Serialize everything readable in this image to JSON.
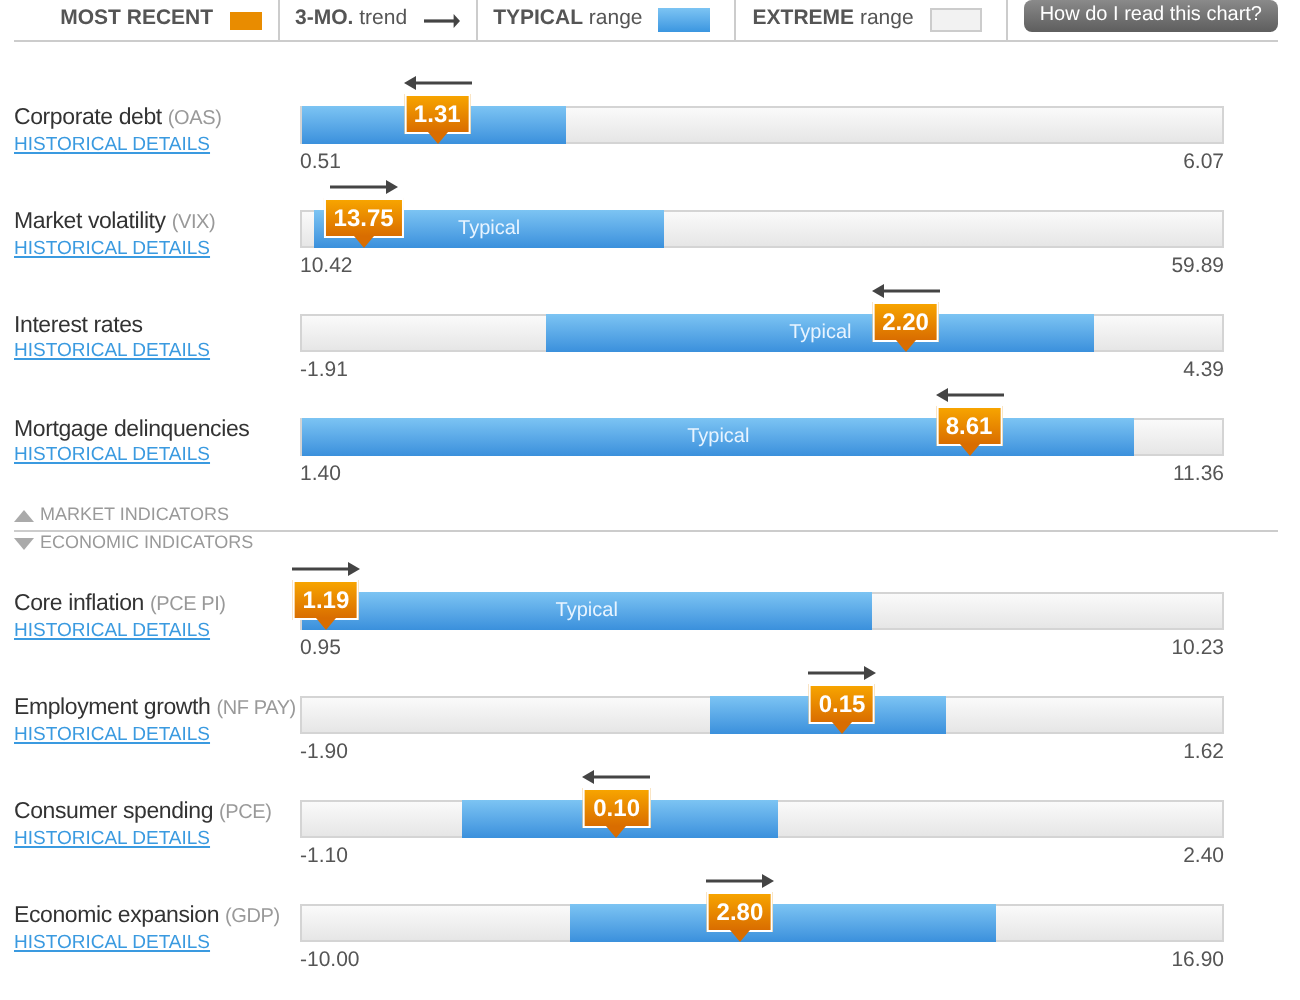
{
  "legend": {
    "most_recent": "MOST RECENT",
    "trend_bold": "3-MO.",
    "trend_rest": "trend",
    "typical_bold": "TYPICAL",
    "typical_rest": "range",
    "extreme_bold": "EXTREME",
    "extreme_rest": "range",
    "help_button": "How do I read this chart?"
  },
  "groups": [
    {
      "rows": [
        {
          "name": "Corporate debt",
          "code": "(OAS)",
          "link": "HISTORICAL DETAILS",
          "min": "0.51",
          "max": "6.07",
          "typical": {
            "level": 0.286
          },
          "marker": {
            "level": 0.147,
            "value": "1.31"
          },
          "trend_rising": false
        },
        {
          "name": "Market volatility",
          "code": "(VIX)",
          "link": "HISTORICAL DETAILS",
          "min": "10.42",
          "max": "59.89",
          "lower_extreme": {
            "level": 0.013
          },
          "typical": {
            "level": 0.394
          },
          "typical_label": "Typical",
          "marker": {
            "level": 0.067,
            "value": "13.75"
          },
          "trend_rising": true
        },
        {
          "name": "Interest rates",
          "link": "HISTORICAL DETAILS",
          "min": "-1.91",
          "max": "4.39",
          "lower_extreme": {
            "level": 0.266
          },
          "typical": {
            "level": 0.861
          },
          "typical_label": "Typical",
          "marker": {
            "level": 0.656,
            "value": "2.20"
          },
          "trend_rising": false
        },
        {
          "name": "Mortgage delinquencies",
          "link": "HISTORICAL DETAILS",
          "min": "1.40",
          "max": "11.36",
          "typical": {
            "level": 0.905
          },
          "typical_label": "Typical",
          "marker": {
            "level": 0.725,
            "value": "8.61"
          },
          "trend_rising": false
        }
      ]
    },
    {
      "sections": [
        {
          "label": "MARKET INDICATORS",
          "expanded": false
        },
        {
          "label": "ECONOMIC INDICATORS",
          "expanded": true
        }
      ],
      "rows": [
        {
          "name": "Core inflation",
          "code": "(PCE PI)",
          "link": "HISTORICAL DETAILS",
          "min": "0.95",
          "max": "10.23",
          "typical": {
            "level": 0.619
          },
          "typical_label": "Typical",
          "marker": {
            "level": 0.026,
            "value": "1.19"
          },
          "trend_rising": true
        },
        {
          "name": "Employment growth",
          "code": "(NF PAY)",
          "link": "HISTORICAL DETAILS",
          "min": "-1.90",
          "max": "1.62",
          "lower_extreme": {
            "level": 0.444
          },
          "typical": {
            "level": 0.701
          },
          "marker": {
            "level": 0.587,
            "value": "0.15"
          },
          "trend_rising": true
        },
        {
          "name": "Consumer spending",
          "code": "(PCE)",
          "link": "HISTORICAL DETAILS",
          "min": "-1.10",
          "max": "2.40",
          "lower_extreme": {
            "level": 0.173
          },
          "typical": {
            "level": 0.517
          },
          "marker": {
            "level": 0.342,
            "value": "0.10"
          },
          "trend_rising": false
        },
        {
          "name": "Economic expansion",
          "code": "(GDP)",
          "link": "HISTORICAL DETAILS",
          "min": "-10.00",
          "max": "16.90",
          "lower_extreme": {
            "level": 0.292
          },
          "typical": {
            "level": 0.755
          },
          "marker": {
            "level": 0.476,
            "value": "2.80"
          },
          "trend_rising": true
        }
      ]
    }
  ]
}
